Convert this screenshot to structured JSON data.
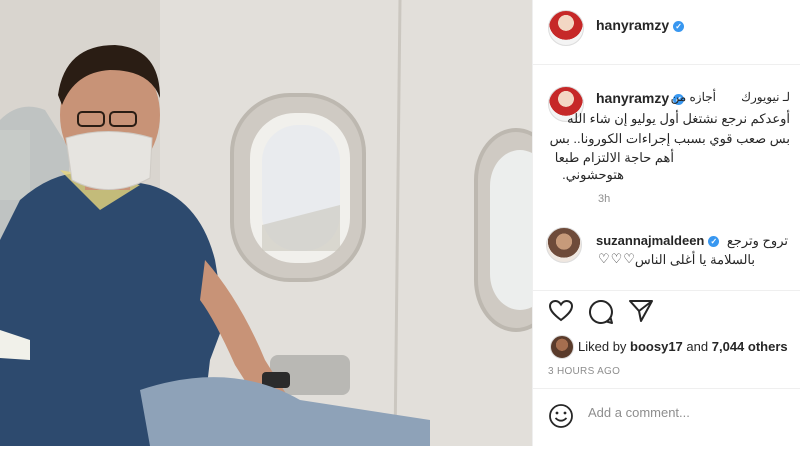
{
  "post": {
    "username": "hanyramzy",
    "caption_user": "hanyramzy",
    "caption_lines": [
      "أجازه من",
      "لـ نيويورك",
      "أوعدكم نرجع نشتغل أول يوليو إن شاء الله",
      "بس صعب قوي بسبب إجراءات الكورونا.. بس",
      "أهم حاجة الالتزام طبعا",
      "هتوحشوني."
    ],
    "caption_time": "3h",
    "comment_user": "suzannajmaldeen",
    "comment_text_1": "تروح وترجع",
    "comment_text_2": "بالسلامة يا أغلى الناس",
    "comment_hearts": "♡♡♡",
    "liked_prefix": "Liked by",
    "liked_user": "boosy17",
    "liked_and": "and",
    "liked_count": "7,044 others",
    "timestamp": "3 HOURS AGO",
    "comment_placeholder": "Add a comment..."
  },
  "icons": {
    "verified": "verified-badge-icon",
    "like": "heart-icon",
    "comment": "comment-bubble-icon",
    "share": "paper-plane-icon",
    "emoji": "smiley-icon"
  },
  "colors": {
    "verified_blue": "#3897f0",
    "text": "#262626",
    "muted": "#8e8e8e"
  }
}
